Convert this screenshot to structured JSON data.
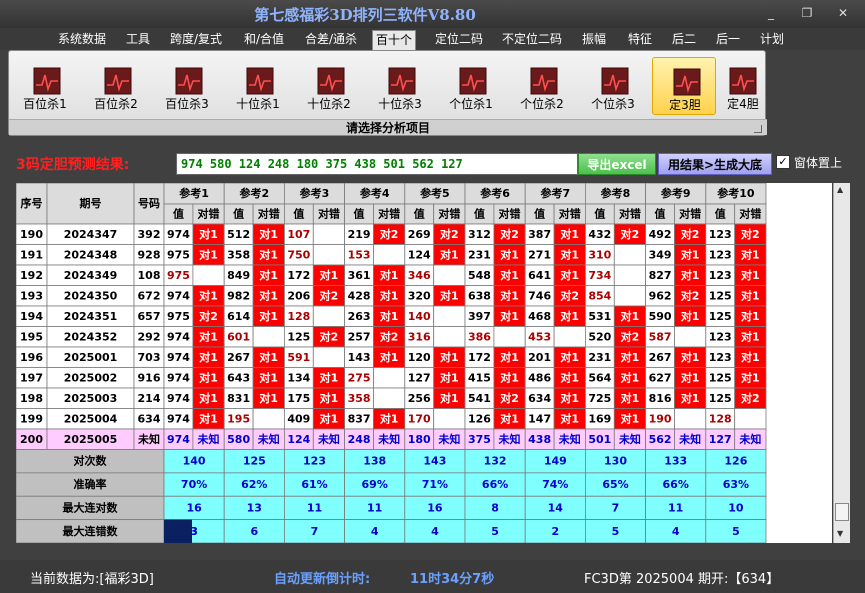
{
  "window": {
    "title": "第七感福彩3D排列三软件V8.80",
    "controls": [
      "_",
      "❐",
      "✕"
    ]
  },
  "menu": [
    "系统数据",
    "工具",
    "跨度/复式",
    "和/合值",
    "合差/通杀",
    "百十个",
    "定位二码",
    "不定位二码",
    "振幅",
    "特征",
    "后二",
    "后一",
    "计划"
  ],
  "menu_active": "百十个",
  "ribbon": {
    "buttons": [
      "百位杀1",
      "百位杀2",
      "百位杀3",
      "十位杀1",
      "十位杀2",
      "十位杀3",
      "个位杀1",
      "个位杀2",
      "个位杀3",
      "定3胆",
      "定4胆"
    ],
    "selected": "定3胆",
    "title": "请选择分析项目"
  },
  "result": {
    "label": "3码定胆预测结果:",
    "value": "974 580 124 248 180 375 438 501 562 127",
    "excel_label": "导出excel",
    "gen_label": "用结果>生成大底",
    "top_check": "✓",
    "top_label": "窗体置上"
  },
  "table": {
    "headers": {
      "seq": "序号",
      "period": "期号",
      "num": "号码",
      "refs": [
        "参考1",
        "参考2",
        "参考3",
        "参考4",
        "参考5",
        "参考6",
        "参考7",
        "参考8",
        "参考9",
        "参考10"
      ],
      "sub_val": "值",
      "sub_res": "对错"
    },
    "rows": [
      {
        "seq": "190",
        "period": "2024347",
        "num": "392",
        "v": [
          "974",
          "512",
          "107",
          "219",
          "269",
          "312",
          "387",
          "432",
          "492",
          "123"
        ],
        "r": [
          "对1",
          "对1",
          "",
          "对2",
          "对2",
          "对2",
          "对1",
          "对2",
          "对2",
          "对2"
        ]
      },
      {
        "seq": "191",
        "period": "2024348",
        "num": "928",
        "v": [
          "975",
          "358",
          "750",
          "153",
          "124",
          "231",
          "271",
          "310",
          "349",
          "123"
        ],
        "r": [
          "对1",
          "对1",
          "",
          "",
          "对1",
          "对1",
          "对1",
          "",
          "对1",
          "对1"
        ]
      },
      {
        "seq": "192",
        "period": "2024349",
        "num": "108",
        "v": [
          "975",
          "849",
          "172",
          "361",
          "346",
          "548",
          "641",
          "734",
          "827",
          "123"
        ],
        "r": [
          "",
          "对1",
          "对1",
          "对1",
          "",
          "对1",
          "对1",
          "",
          "对1",
          "对1"
        ]
      },
      {
        "seq": "193",
        "period": "2024350",
        "num": "672",
        "v": [
          "974",
          "982",
          "206",
          "428",
          "320",
          "638",
          "746",
          "854",
          "962",
          "125"
        ],
        "r": [
          "对1",
          "对1",
          "对2",
          "对1",
          "对1",
          "对1",
          "对2",
          "",
          "对2",
          "对1"
        ]
      },
      {
        "seq": "194",
        "period": "2024351",
        "num": "657",
        "v": [
          "975",
          "614",
          "128",
          "263",
          "140",
          "397",
          "468",
          "531",
          "590",
          "125"
        ],
        "r": [
          "对2",
          "对1",
          "",
          "对1",
          "",
          "对1",
          "对1",
          "对1",
          "对1",
          "对1"
        ]
      },
      {
        "seq": "195",
        "period": "2024352",
        "num": "292",
        "v": [
          "974",
          "601",
          "125",
          "257",
          "316",
          "386",
          "453",
          "520",
          "587",
          "123"
        ],
        "r": [
          "对1",
          "",
          "对2",
          "对2",
          "",
          "",
          "",
          "对2",
          "",
          "对1"
        ]
      },
      {
        "seq": "196",
        "period": "2025001",
        "num": "703",
        "v": [
          "974",
          "267",
          "591",
          "143",
          "120",
          "172",
          "201",
          "231",
          "267",
          "123"
        ],
        "r": [
          "对1",
          "对1",
          "",
          "对1",
          "对1",
          "对1",
          "对1",
          "对1",
          "对1",
          "对1"
        ]
      },
      {
        "seq": "197",
        "period": "2025002",
        "num": "916",
        "v": [
          "974",
          "643",
          "134",
          "275",
          "127",
          "415",
          "486",
          "564",
          "627",
          "125"
        ],
        "r": [
          "对1",
          "对1",
          "对1",
          "",
          "对1",
          "对1",
          "对1",
          "对1",
          "对1",
          "对1"
        ]
      },
      {
        "seq": "198",
        "period": "2025003",
        "num": "214",
        "v": [
          "974",
          "831",
          "175",
          "358",
          "256",
          "541",
          "634",
          "725",
          "816",
          "125"
        ],
        "r": [
          "对1",
          "对1",
          "对1",
          "",
          "对1",
          "对2",
          "对1",
          "对1",
          "对1",
          "对2"
        ]
      },
      {
        "seq": "199",
        "period": "2025004",
        "num": "634",
        "v": [
          "974",
          "195",
          "409",
          "837",
          "170",
          "126",
          "147",
          "169",
          "190",
          "128"
        ],
        "r": [
          "对1",
          "",
          "对1",
          "对1",
          "",
          "对1",
          "对1",
          "对1",
          "",
          ""
        ]
      },
      {
        "seq": "200",
        "period": "2025005",
        "num": "未知",
        "v": [
          "974",
          "580",
          "124",
          "248",
          "180",
          "375",
          "438",
          "501",
          "562",
          "127"
        ],
        "r": [
          "未知",
          "未知",
          "未知",
          "未知",
          "未知",
          "未知",
          "未知",
          "未知",
          "未知",
          "未知"
        ]
      }
    ],
    "stats": [
      {
        "label": "对次数",
        "vals": [
          "140",
          "125",
          "123",
          "138",
          "143",
          "132",
          "149",
          "130",
          "133",
          "126"
        ]
      },
      {
        "label": "准确率",
        "vals": [
          "70%",
          "62%",
          "61%",
          "69%",
          "71%",
          "66%",
          "74%",
          "65%",
          "66%",
          "63%"
        ]
      },
      {
        "label": "最大连对数",
        "vals": [
          "16",
          "13",
          "11",
          "11",
          "16",
          "8",
          "14",
          "7",
          "11",
          "10"
        ]
      },
      {
        "label": "最大连错数",
        "vals": [
          "3",
          "6",
          "7",
          "4",
          "4",
          "5",
          "2",
          "5",
          "4",
          "5"
        ]
      }
    ]
  },
  "status": {
    "current": "当前数据为:[福彩3D]",
    "countdown_label": "自动更新倒计时:",
    "countdown": "11时34分7秒",
    "fc": "FC3D第 2025004 期开:【634】"
  },
  "colors": {
    "red": "#ff0000",
    "cyan": "#80ffff",
    "pink": "#ffccff",
    "header": "#dcdcdc",
    "gray": "#c0c0c0"
  }
}
